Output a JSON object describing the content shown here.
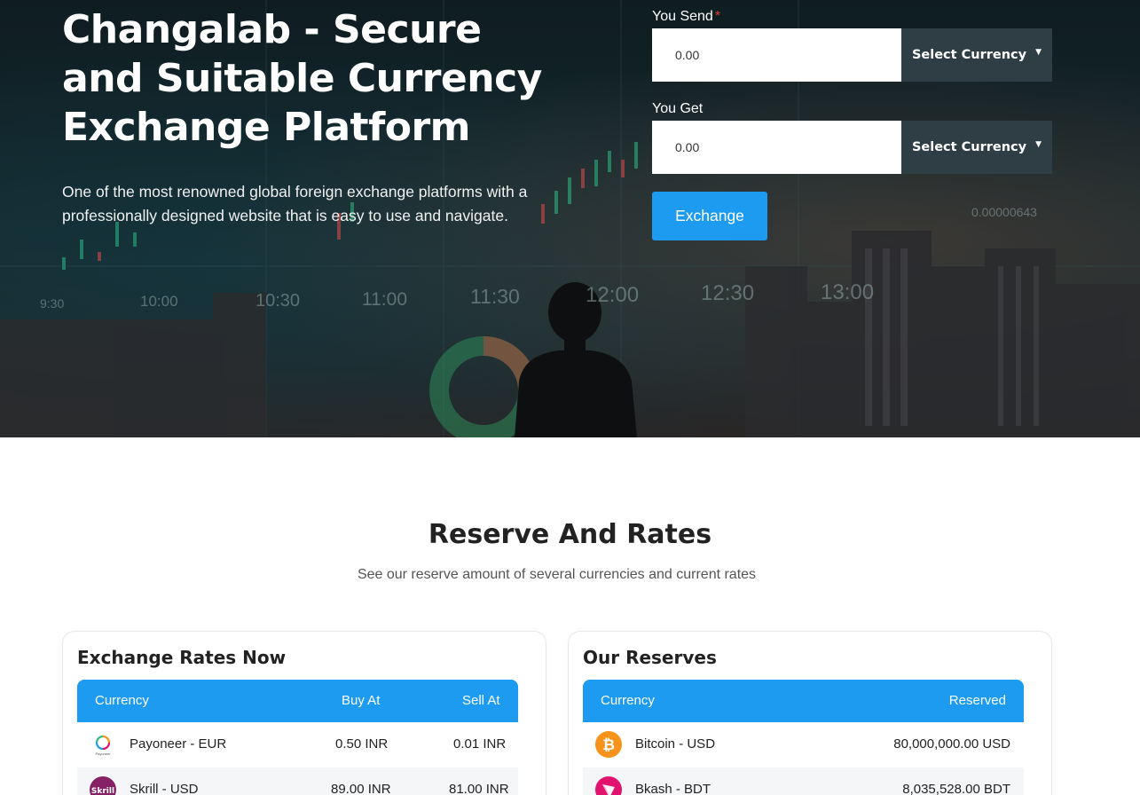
{
  "hero": {
    "title": "Changalab - Secure and Suitable Currency Exchange Platform",
    "description": "One of the most renowned global foreign exchange platforms with a professionally designed website that is easy to use and navigate.",
    "background_ticks": [
      "9:30",
      "10:00",
      "10:30",
      "11:00",
      "11:30",
      "12:00",
      "12:30",
      "13:00"
    ],
    "background_price": "0.00000643"
  },
  "form": {
    "send_label": "You Send",
    "send_required_mark": "*",
    "send_value": "0.00",
    "send_currency": "Select Currency",
    "get_label": "You Get",
    "get_value": "0.00",
    "get_currency": "Select Currency",
    "exchange_button": "Exchange"
  },
  "reserves_section": {
    "title": "Reserve And Rates",
    "subtitle": "See our reserve amount of several currencies and current rates"
  },
  "rates_table": {
    "title": "Exchange Rates Now",
    "headers": {
      "currency": "Currency",
      "buy": "Buy At",
      "sell": "Sell At"
    },
    "rows": [
      {
        "currency": "Payoneer - EUR",
        "buy": "0.50 INR",
        "sell": "0.01 INR",
        "icon": "payoneer-icon",
        "logo_text": "Payoneer"
      },
      {
        "currency": "Skrill - USD",
        "buy": "89.00 INR",
        "sell": "81.00 INR",
        "icon": "skrill-icon",
        "logo_text": "Skrill"
      }
    ]
  },
  "reserves_table": {
    "title": "Our Reserves",
    "headers": {
      "currency": "Currency",
      "reserved": "Reserved"
    },
    "rows": [
      {
        "currency": "Bitcoin - USD",
        "reserved": "80,000,000.00 USD",
        "icon": "bitcoin-icon"
      },
      {
        "currency": "Bkash - BDT",
        "reserved": "8,035,528.00 BDT",
        "icon": "bkash-icon"
      }
    ]
  },
  "colors": {
    "accent": "#1d9bf0",
    "select_bg": "#2f3d45",
    "required": "#e53935",
    "bitcoin": "#f7931a",
    "bkash": "#e2136e",
    "skrill": "#862165"
  }
}
